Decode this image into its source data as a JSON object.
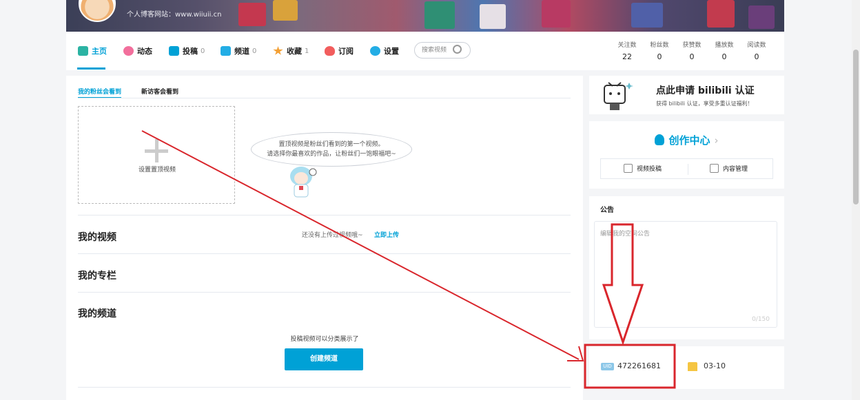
{
  "header": {
    "site_text": "个人博客网站：www.wiiuii.cn"
  },
  "nav": {
    "items": [
      {
        "label": "主页",
        "count": ""
      },
      {
        "label": "动态",
        "count": ""
      },
      {
        "label": "投稿",
        "count": "0"
      },
      {
        "label": "频道",
        "count": "0"
      },
      {
        "label": "收藏",
        "count": "1"
      },
      {
        "label": "订阅",
        "count": ""
      },
      {
        "label": "设置",
        "count": ""
      }
    ],
    "search_placeholder": "搜索视频",
    "stats": [
      {
        "label": "关注数",
        "value": "22"
      },
      {
        "label": "粉丝数",
        "value": "0"
      },
      {
        "label": "获赞数",
        "value": "0"
      },
      {
        "label": "播放数",
        "value": "0"
      },
      {
        "label": "阅读数",
        "value": "0"
      }
    ]
  },
  "main": {
    "tabs": [
      "我的粉丝会看到",
      "新访客会看到"
    ],
    "top_video_label": "设置置顶视频",
    "bubble_line1": "置顶视频是粉丝们看到的第一个视频。",
    "bubble_line2": "请选择你最喜欢的作品，让粉丝们一饱眼福吧~",
    "my_videos": "我的视频",
    "no_upload": "还没有上传过视频哦~",
    "upload_now": "立即上传",
    "my_column": "我的专栏",
    "my_channel": "我的频道",
    "channel_hint": "投稿视频可以分类展示了",
    "create_channel": "创建频道"
  },
  "sidebar": {
    "verify_title": "点此申请 bilibili 认证",
    "verify_sub": "获得 bilibili 认证，享受多重认证福利！",
    "creator_center": "创作中心",
    "video_submit": "视频投稿",
    "content_manage": "内容管理",
    "notice_title": "公告",
    "notice_placeholder": "编辑我的空间公告",
    "notice_count": "0/150",
    "uid_badge": "UID",
    "uid": "472261681",
    "birthday": "03-10"
  },
  "colors": {
    "accent": "#00a1d6",
    "annotation": "#d9262c"
  }
}
